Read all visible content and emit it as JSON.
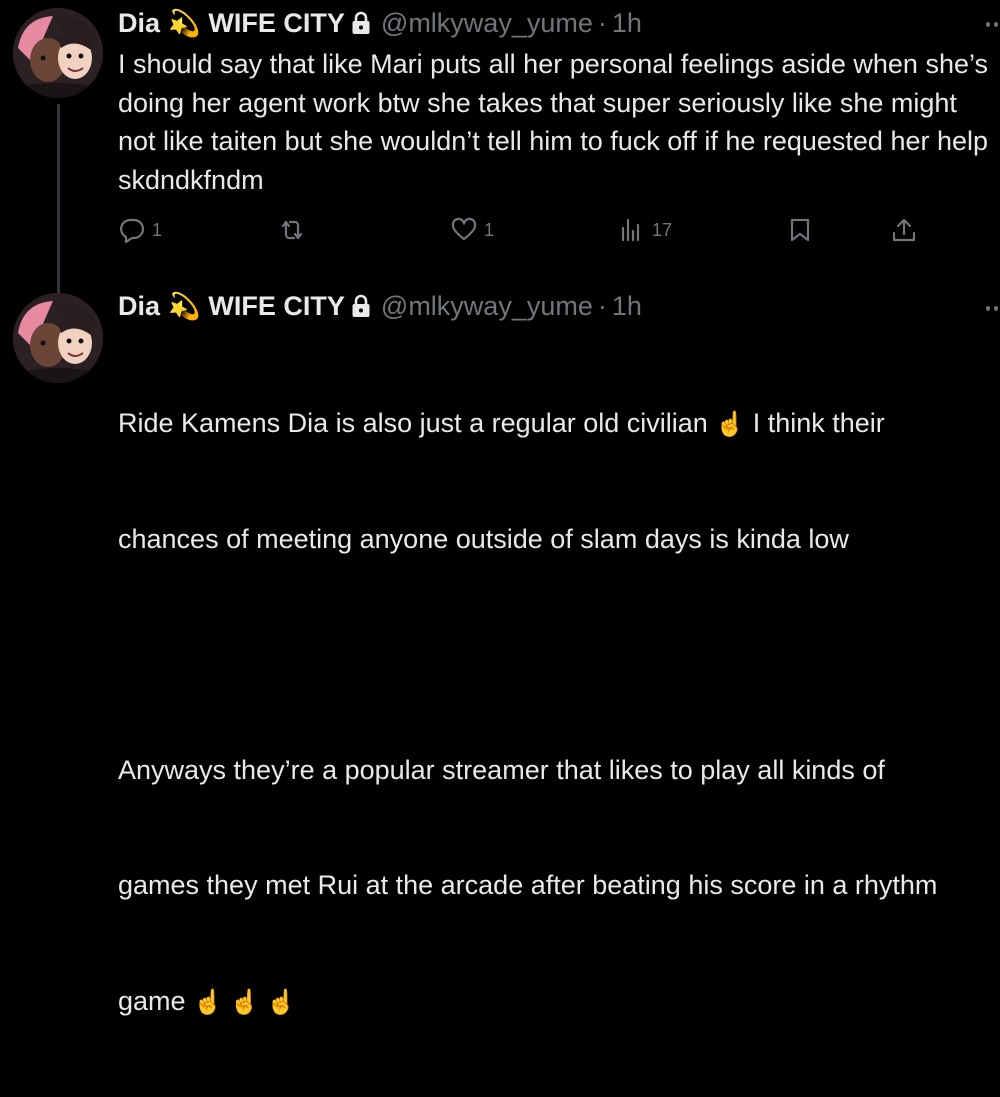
{
  "tweets": [
    {
      "author": {
        "display_name": "Dia",
        "display_name_suffix": "WIFE CITY",
        "name_emoji": "💫",
        "handle": "@mlkyway_yume",
        "verified_lock": "lock-icon"
      },
      "separator": "·",
      "time": "1h",
      "text": "I should say that like Mari puts all her personal feelings aside when she’s doing her agent work btw she takes that super seriously like she might not like taiten but she wouldn’t tell him to fuck off if he requested her help skdndkfndm",
      "actions": {
        "reply_count": "1",
        "retweet_count": "",
        "like_count": "1",
        "view_count": "17"
      }
    },
    {
      "author": {
        "display_name": "Dia",
        "display_name_suffix": "WIFE CITY",
        "name_emoji": "💫",
        "handle": "@mlkyway_yume",
        "verified_lock": "lock-icon"
      },
      "separator": "·",
      "time": "1h",
      "lines": [
        "Ride Kamens Dia is also just a regular old civilian",
        "☝️",
        "I think their",
        "chances of meeting anyone outside of slam days is kinda low",
        "",
        "Anyways they’re a popular streamer that likes to play all kinds of",
        "games they met Rui at the arcade after beating his score in a rhythm",
        "game",
        "☝️ ☝️ ☝️"
      ]
    }
  ],
  "colors": {
    "background": "#000000",
    "text_primary": "#e7e9ea",
    "text_secondary": "#71767b",
    "thread_line": "#333639"
  },
  "icons": [
    "reply-icon",
    "retweet-icon",
    "like-icon",
    "views-icon",
    "bookmark-icon",
    "share-icon",
    "more-icon",
    "lock-icon"
  ]
}
